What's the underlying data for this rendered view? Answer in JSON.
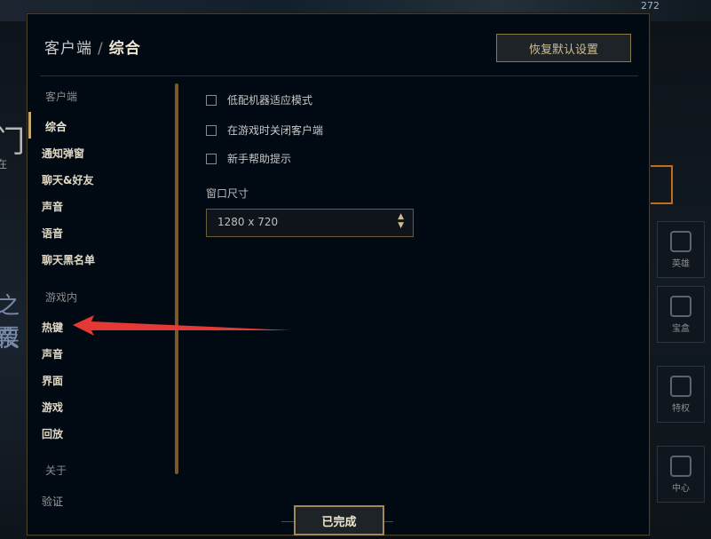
{
  "background": {
    "count_text": "272",
    "left_big": "门",
    "left_small": "在",
    "left_b2": "之夜",
    "left_b3": "票",
    "right_panels": [
      "英雄",
      "宝盒",
      "特权",
      "中心"
    ]
  },
  "dialog": {
    "breadcrumb_parent": "客户端",
    "breadcrumb_sep": "/",
    "breadcrumb_current": "综合",
    "restore_defaults": "恢复默认设置",
    "done": "已完成"
  },
  "sidebar": {
    "sections": [
      {
        "label": "客户端",
        "items": [
          "综合",
          "通知弹窗",
          "聊天&好友",
          "声音",
          "语音",
          "聊天黑名单"
        ]
      },
      {
        "label": "游戏内",
        "items": [
          "热键",
          "声音",
          "界面",
          "游戏",
          "回放"
        ]
      },
      {
        "label": "关于",
        "items": [
          "验证"
        ]
      }
    ],
    "active_item": "综合"
  },
  "settings": {
    "checkboxes": [
      {
        "label": "低配机器适应模式",
        "checked": false
      },
      {
        "label": "在游戏时关闭客户端",
        "checked": false
      },
      {
        "label": "新手帮助提示",
        "checked": false
      }
    ],
    "window_size_label": "窗口尺寸",
    "window_size_value": "1280 x 720"
  },
  "annotation": {
    "color": "#e53935",
    "points_to": "热键"
  },
  "colors": {
    "gold": "#c8aa6e",
    "accent_border": "#785a28",
    "dialog_bg": "#010a13"
  }
}
